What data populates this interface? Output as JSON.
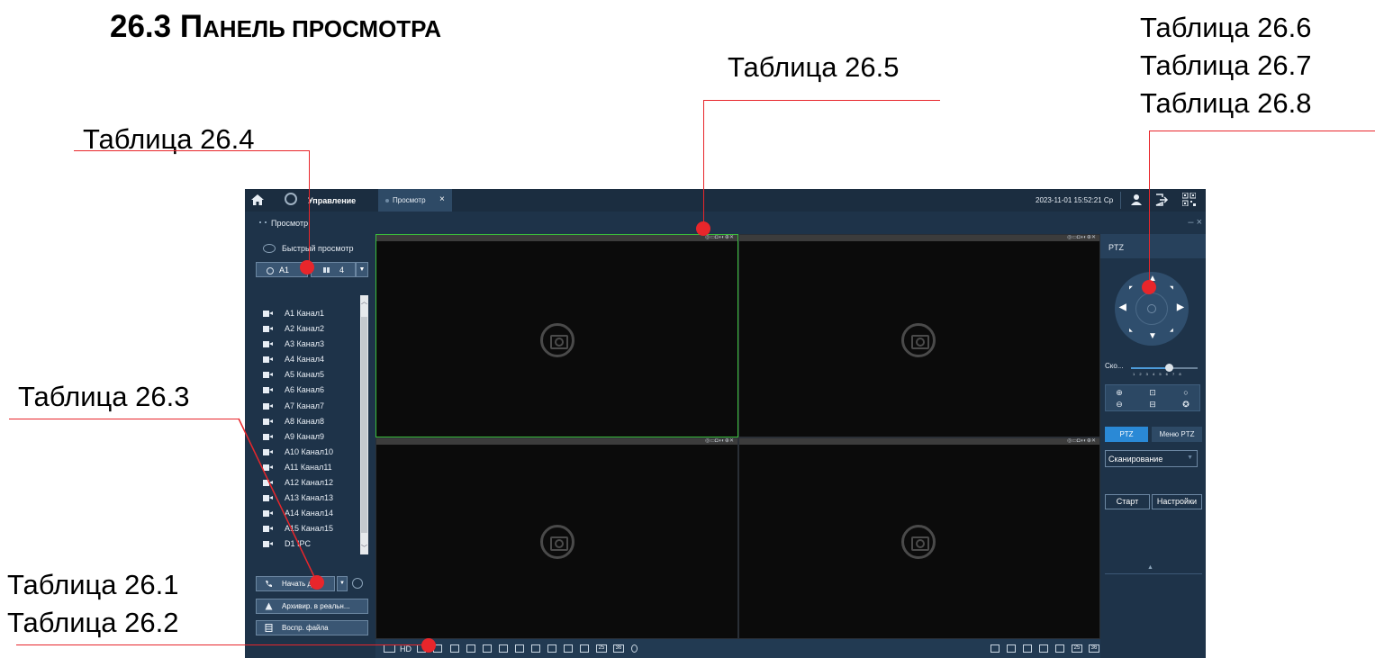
{
  "heading": {
    "num": "26.3 ",
    "first": "П",
    "rest": "АНЕЛЬ ПРОСМОТРА"
  },
  "annotations": {
    "t264": "Таблица 26.4",
    "t265": "Таблица 26.5",
    "t266": "Таблица 26.6",
    "t267": "Таблица 26.7",
    "t268": "Таблица 26.8",
    "t263": "Таблица 26.3",
    "t261": "Таблица 26.1",
    "t262": "Таблица 26.2"
  },
  "app": {
    "topbar": {
      "management": "Управление",
      "tab_label": "Просмотр",
      "tab_close": "×",
      "datetime": "2023-11-01 15:52:21 Ср"
    },
    "subbar": {
      "title": "Просмотр",
      "controls": "– ×"
    },
    "left": {
      "quick_view": "Быстрый просмотр",
      "device_sel": "A1",
      "layout_sel": "4",
      "channels": [
        "A1 Канал1",
        "A2 Канал2",
        "A3 Канал3",
        "A4 Канал4",
        "A5 Канал5",
        "A6 Канал6",
        "A7 Канал7",
        "A8 Канал8",
        "A9 Канал9",
        "A10 Канал10",
        "A11 Канал11",
        "A12 Канал12",
        "A13 Канал13",
        "A14 Канал14",
        "A15 Канал15",
        "D1 IPC"
      ],
      "start_call": "Начать ди...",
      "archive_realtime": "Архивир. в реальн...",
      "file_playback": "Воспр. файла"
    },
    "bottombar": {
      "hd": "HD",
      "n25": "25",
      "n36": "36"
    },
    "ptz": {
      "title": "PTZ",
      "speed_label": "Ско...",
      "speed_ticks": "1 2 3 4 5 6 7 8",
      "tab_ptz": "PTZ",
      "tab_menu": "Меню PTZ",
      "scan_value": "Сканирование",
      "start": "Старт",
      "settings": "Настройки"
    }
  },
  "colors": {
    "accent": "#e8262b",
    "app_bg": "#223a52",
    "selected_tile": "#3bbd3b",
    "ptz_tab": "#2a89d6"
  }
}
